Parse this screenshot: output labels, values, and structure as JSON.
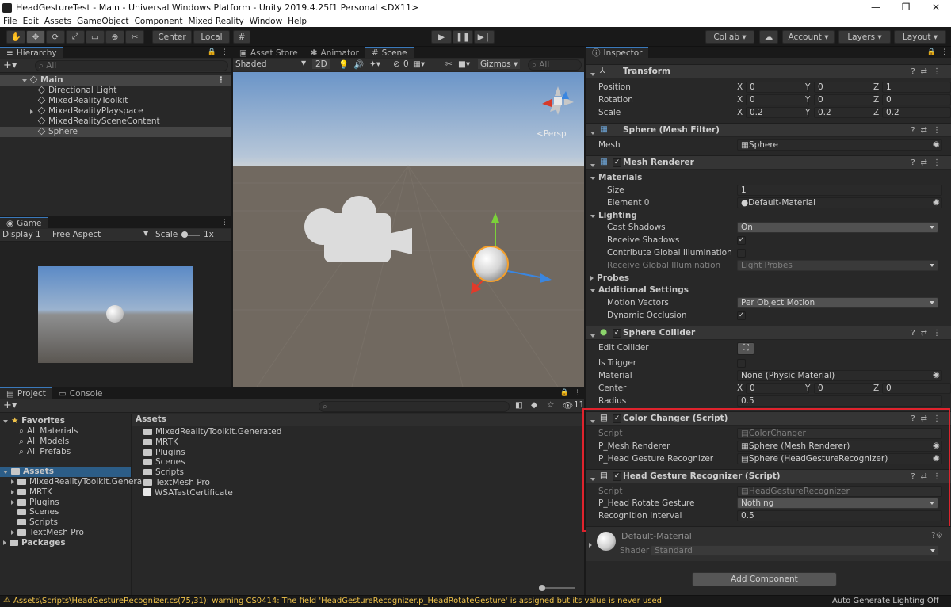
{
  "window": {
    "title": "HeadGestureTest - Main - Universal Windows Platform - Unity 2019.4.25f1 Personal <DX11>",
    "controls": [
      "—",
      "❐",
      "✕"
    ]
  },
  "menu": [
    "File",
    "Edit",
    "Assets",
    "GameObject",
    "Component",
    "Mixed Reality",
    "Window",
    "Help"
  ],
  "toolbar": {
    "center_label": "Center",
    "local_label": "Local",
    "collab_label": "Collab",
    "account_label": "Account",
    "layers_label": "Layers",
    "layout_label": "Layout"
  },
  "hierarchy": {
    "tab": "Hierarchy",
    "search_placeholder": "All",
    "scene_name": "Main",
    "items": [
      {
        "name": "Directional Light",
        "expandable": false,
        "selected": false
      },
      {
        "name": "MixedRealityToolkit",
        "expandable": false,
        "selected": false
      },
      {
        "name": "MixedRealityPlayspace",
        "expandable": true,
        "selected": false
      },
      {
        "name": "MixedRealitySceneContent",
        "expandable": false,
        "selected": false
      },
      {
        "name": "Sphere",
        "expandable": false,
        "selected": true
      }
    ]
  },
  "game": {
    "tab": "Game",
    "display": "Display 1",
    "aspect": "Free Aspect",
    "scale_label": "Scale",
    "scale_value": "1x"
  },
  "scene": {
    "tabs": [
      "Asset Store",
      "Animator",
      "Scene"
    ],
    "active_tab": "Scene",
    "shading": "Shaded",
    "mode_2d": "2D",
    "fx_count": "0",
    "gizmos_label": "Gizmos",
    "search_placeholder": "All",
    "persp_label": "Persp"
  },
  "project": {
    "tabs": [
      "Project",
      "Console"
    ],
    "breadcrumb": "Assets",
    "hidden_count": "11",
    "favorites_label": "Favorites",
    "favorites": [
      "All Materials",
      "All Models",
      "All Prefabs"
    ],
    "assets_label": "Assets",
    "asset_tree": [
      "MixedRealityToolkit.Genera",
      "MRTK",
      "Plugins",
      "Scenes",
      "Scripts",
      "TextMesh Pro"
    ],
    "packages_label": "Packages",
    "grid_items": [
      "MixedRealityToolkit.Generated",
      "MRTK",
      "Plugins",
      "Scenes",
      "Scripts",
      "TextMesh Pro",
      "WSATestCertificate"
    ]
  },
  "inspector": {
    "tab": "Inspector",
    "transform": {
      "title": "Transform",
      "position_label": "Position",
      "position": {
        "x": "0",
        "y": "0",
        "z": "1"
      },
      "rotation_label": "Rotation",
      "rotation": {
        "x": "0",
        "y": "0",
        "z": "0"
      },
      "scale_label": "Scale",
      "scale": {
        "x": "0.2",
        "y": "0.2",
        "z": "0.2"
      }
    },
    "mesh_filter": {
      "title": "Sphere (Mesh Filter)",
      "mesh_label": "Mesh",
      "mesh_value": "Sphere"
    },
    "mesh_renderer": {
      "title": "Mesh Renderer",
      "materials_label": "Materials",
      "size_label": "Size",
      "size_value": "1",
      "element0_label": "Element 0",
      "element0_value": "Default-Material",
      "lighting_label": "Lighting",
      "cast_shadows_label": "Cast Shadows",
      "cast_shadows_value": "On",
      "receive_shadows_label": "Receive Shadows",
      "contribute_gi_label": "Contribute Global Illumination",
      "receive_gi_label": "Receive Global Illumination",
      "receive_gi_value": "Light Probes",
      "probes_label": "Probes",
      "additional_label": "Additional Settings",
      "motion_vectors_label": "Motion Vectors",
      "motion_vectors_value": "Per Object Motion",
      "dynamic_occlusion_label": "Dynamic Occlusion"
    },
    "sphere_collider": {
      "title": "Sphere Collider",
      "edit_collider_label": "Edit Collider",
      "is_trigger_label": "Is Trigger",
      "material_label": "Material",
      "material_value": "None (Physic Material)",
      "center_label": "Center",
      "center": {
        "x": "0",
        "y": "0",
        "z": "0"
      },
      "radius_label": "Radius",
      "radius_value": "0.5"
    },
    "color_changer": {
      "title": "Color Changer (Script)",
      "script_label": "Script",
      "script_value": "ColorChanger",
      "mesh_renderer_label": "P_Mesh Renderer",
      "mesh_renderer_value": "Sphere (Mesh Renderer)",
      "head_gesture_label": "P_Head Gesture Recognizer",
      "head_gesture_value": "Sphere (HeadGestureRecognizer)"
    },
    "head_gesture": {
      "title": "Head Gesture Recognizer (Script)",
      "script_label": "Script",
      "script_value": "HeadGestureRecognizer",
      "rotate_gesture_label": "P_Head Rotate Gesture",
      "rotate_gesture_value": "Nothing",
      "interval_label": "Recognition Interval",
      "interval_value": "0.5"
    },
    "material": {
      "name": "Default-Material",
      "shader_label": "Shader",
      "shader_value": "Standard"
    },
    "add_component_label": "Add Component"
  },
  "status": {
    "message": "Assets\\Scripts\\HeadGestureRecognizer.cs(75,31): warning CS0414: The field 'HeadGestureRecognizer.p_HeadRotateGesture' is assigned but its value is never used",
    "lighting": "Auto Generate Lighting Off"
  },
  "colors": {
    "highlight_box": "#e0232d",
    "selection": "#2c5d87",
    "warning": "#f0c34a"
  }
}
